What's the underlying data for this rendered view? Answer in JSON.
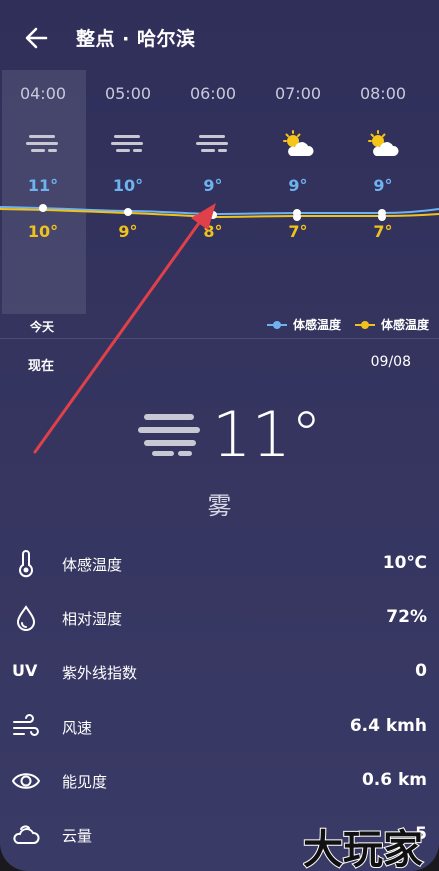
{
  "header": {
    "title": "整点 · 哈尔滨"
  },
  "hourly": [
    {
      "time": "04:00",
      "icon": "fog-icon",
      "hi": "11°",
      "lo": "10°"
    },
    {
      "time": "05:00",
      "icon": "fog-icon",
      "hi": "10°",
      "lo": "9°"
    },
    {
      "time": "06:00",
      "icon": "fog-icon",
      "hi": "9°",
      "lo": "8°"
    },
    {
      "time": "07:00",
      "icon": "partly-cloudy-icon",
      "hi": "9°",
      "lo": "7°"
    },
    {
      "time": "08:00",
      "icon": "partly-cloudy-icon",
      "hi": "9°",
      "lo": "7°"
    }
  ],
  "today_label": "今天",
  "legend": [
    {
      "label": "体感温度",
      "color": "#6eb3f0"
    },
    {
      "label": "体感温度",
      "color": "#f0c21c"
    }
  ],
  "now": {
    "label": "现在",
    "date": "09/08",
    "temp": "11°",
    "condition": "雾",
    "icon": "fog-icon"
  },
  "details": [
    {
      "icon": "thermometer-icon",
      "label": "体感温度",
      "value": "10℃"
    },
    {
      "icon": "droplet-icon",
      "label": "相对湿度",
      "value": "72%"
    },
    {
      "icon": "uv-icon",
      "label": "紫外线指数",
      "value": "0",
      "icon_text": "UV"
    },
    {
      "icon": "wind-icon",
      "label": "风速",
      "value": "6.4 kmh"
    },
    {
      "icon": "eye-icon",
      "label": "能见度",
      "value": "0.6 km"
    },
    {
      "icon": "cloud-icon",
      "label": "云量",
      "value": "5"
    }
  ],
  "watermark": "大玩家",
  "colors": {
    "hi": "#6eb3f0",
    "lo": "#f0c21c",
    "annotation": "#e0404a"
  }
}
